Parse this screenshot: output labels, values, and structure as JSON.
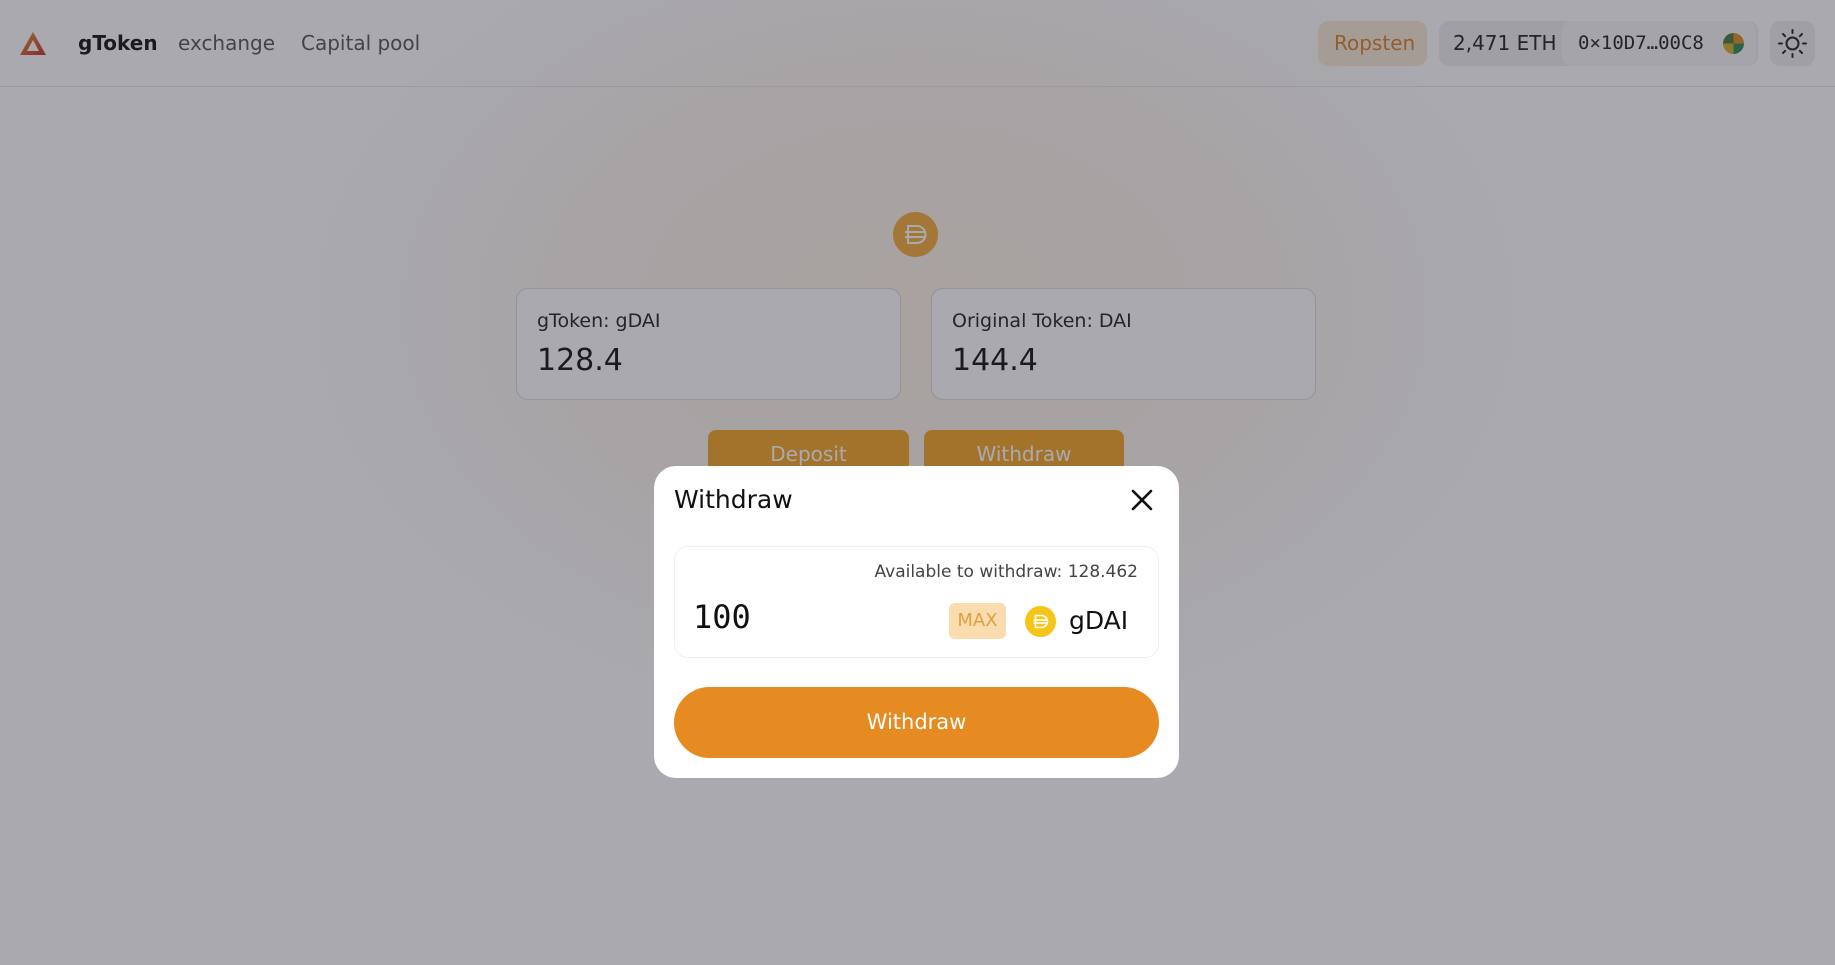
{
  "header": {
    "brand": "gToken",
    "nav": [
      "exchange",
      "Capital pool"
    ],
    "network": "Ropsten",
    "eth_balance": "2,471 ETH",
    "address": "0×10D7…00C8",
    "theme_icon": "sun-icon",
    "logo_icon": "gtoken-logo-icon"
  },
  "main": {
    "token_icon": "dai-icon",
    "cards": [
      {
        "label": "gToken: gDAI",
        "value": "128.4"
      },
      {
        "label": "Original Token: DAI",
        "value": "144.4"
      }
    ],
    "deposit_label": "Deposit",
    "withdraw_label": "Withdraw"
  },
  "modal": {
    "title": "Withdraw",
    "available": "Available to withdraw: 128.462",
    "amount": "100",
    "max_label": "MAX",
    "token_symbol": "gDAI",
    "submit_label": "Withdraw",
    "close_icon": "close-icon"
  },
  "colors": {
    "accent": "#E68A22",
    "network_bg": "#FBE9D6",
    "dai": "#F5AC37"
  }
}
